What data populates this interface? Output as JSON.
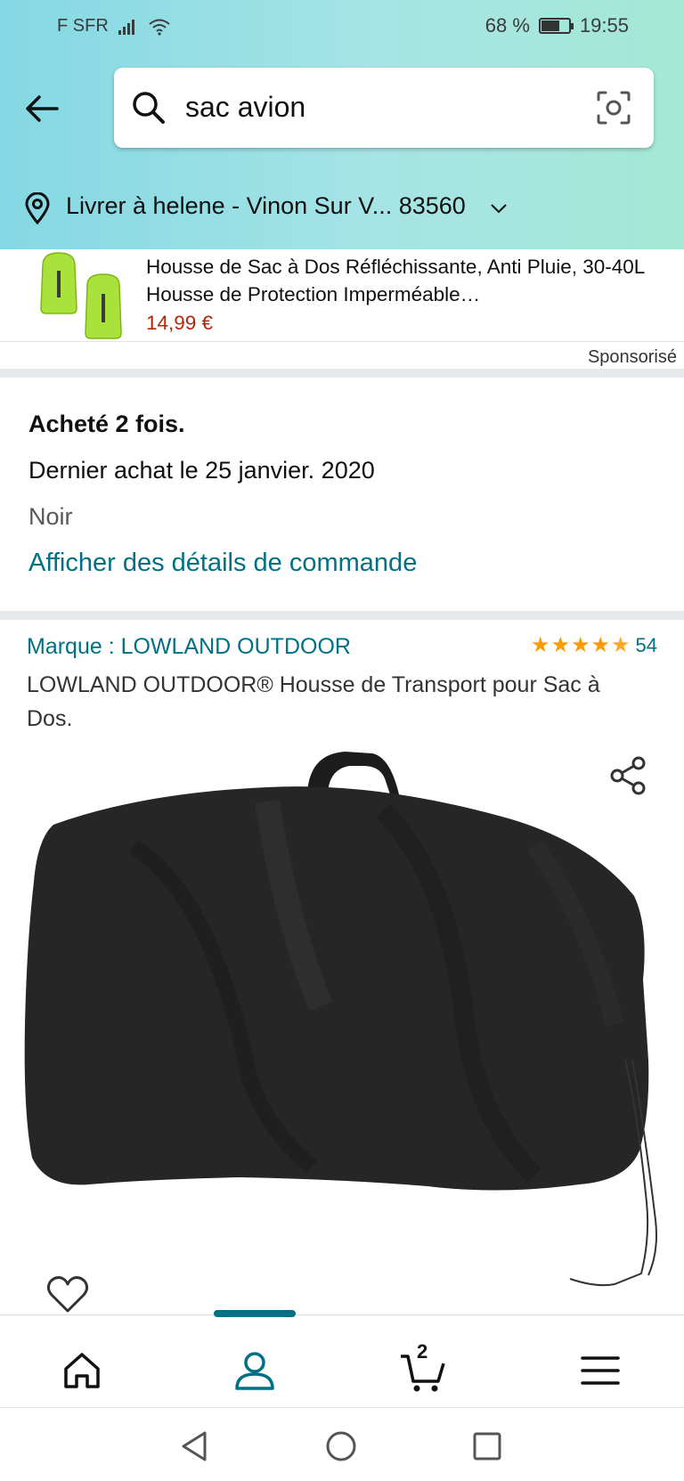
{
  "status_bar": {
    "carrier": "F SFR",
    "battery_percent": "68 %",
    "battery_level": 0.68,
    "time": "19:55"
  },
  "search": {
    "query": "sac avion",
    "back_icon": "back-arrow-icon",
    "search_icon": "search-icon",
    "camera_icon": "camera-icon"
  },
  "delivery": {
    "text": "Livrer à helene - Vinon Sur V... 83560",
    "icon": "location-pin-icon"
  },
  "sponsored_ad": {
    "title": "Housse de Sac à Dos Réfléchissante, Anti Pluie, 30-40L Housse de Protection Imperméable…",
    "price": "14,99 €",
    "label": "Sponsorisé"
  },
  "order_info": {
    "bought_times": "Acheté 2 fois.",
    "last_purchase": "Dernier achat le 25 janvier. 2020",
    "color": "Noir",
    "details_link": "Afficher des détails de commande"
  },
  "product": {
    "brand": "Marque : LOWLAND OUTDOOR",
    "rating_value": 4.5,
    "rating_count": "54",
    "title": "LOWLAND OUTDOOR® Housse de Transport pour Sac à Dos."
  },
  "bottom_nav": {
    "items": [
      "home",
      "account",
      "cart",
      "menu"
    ],
    "active": "account",
    "cart_count": "2",
    "accent_color": "#007185"
  },
  "colors": {
    "link": "#007185",
    "price": "#b12704",
    "star": "#ff9900"
  }
}
